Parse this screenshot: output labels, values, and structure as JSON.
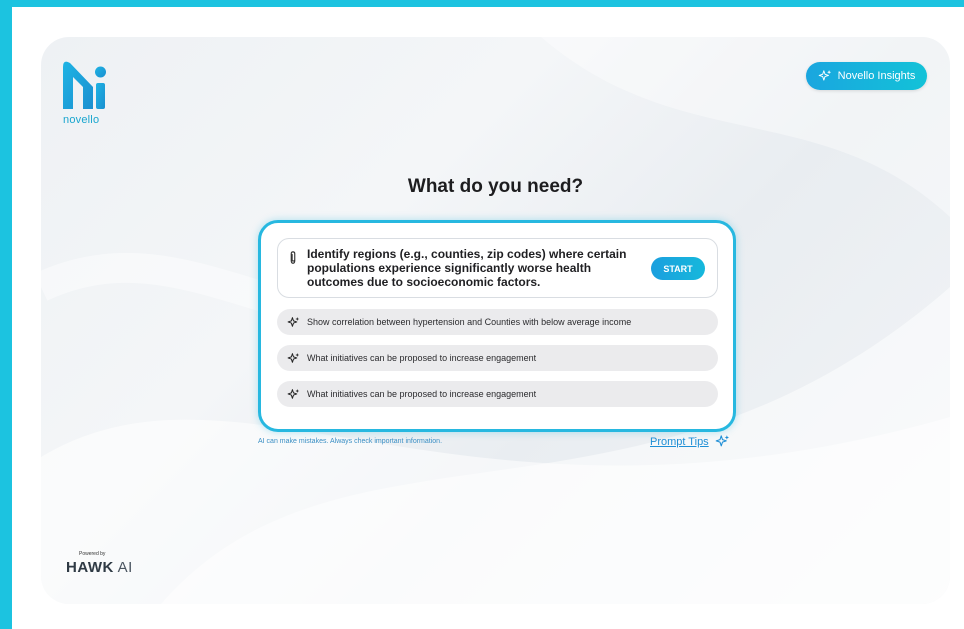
{
  "brand": {
    "logo_text": "novello",
    "colors": {
      "accent": "#1aa6df",
      "frame": "#1cc3e0",
      "logo": "#1aa6cf"
    }
  },
  "header": {
    "insights_button": {
      "label": "Novello Insights",
      "icon": "sparkle-icon"
    }
  },
  "main": {
    "title": "What do you need?",
    "prompt": {
      "icon": "paperclip-icon",
      "text": "Identify regions (e.g., counties, zip codes) where certain populations experience significantly worse health outcomes due to socioeconomic factors.",
      "start_label": "START"
    },
    "suggestions": [
      {
        "icon": "sparkle-icon",
        "label": "Show correlation between hypertension and Counties with below average income"
      },
      {
        "icon": "sparkle-icon",
        "label": "What initiatives can be proposed to increase engagement"
      },
      {
        "icon": "sparkle-icon",
        "label": "What initiatives can be proposed to increase engagement"
      }
    ],
    "disclaimer": "AI can make mistakes. Always check important information.",
    "prompt_tips": {
      "label": "Prompt Tips",
      "icon": "sparkle-icon"
    }
  },
  "footer": {
    "powered_by": "Powered by",
    "company_bold": "HAWK",
    "company_light": "AI"
  }
}
